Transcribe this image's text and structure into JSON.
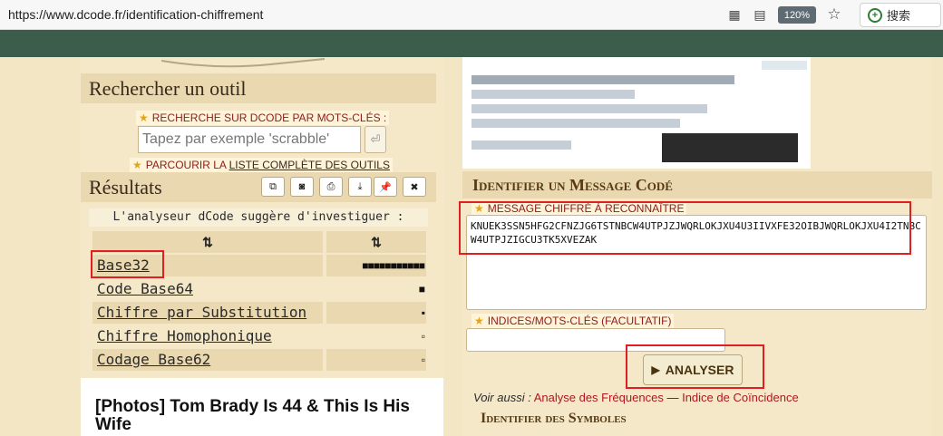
{
  "browser": {
    "url": "https://www.dcode.fr/identification-chiffrement",
    "zoom": "120%",
    "search_label": "搜索"
  },
  "left": {
    "search_title": "Rechercher un outil",
    "keyword_label": "RECHERCHE SUR DCODE PAR MOTS-CLÉS :",
    "search_placeholder": "Tapez par exemple 'scrabble'",
    "browse_prefix": "PARCOURIR LA",
    "browse_link": "LISTE COMPLÈTE DES OUTILS",
    "results_title": "Résultats",
    "analyser_message": "L'analyseur dCode suggère d'investiguer :",
    "sort_icon": "⇅",
    "results": [
      {
        "name": "Base32",
        "score_bar": "■■■■■■■■■■■"
      },
      {
        "name": "Code Base64",
        "score_bar": "■"
      },
      {
        "name": "Chiffre par Substitution",
        "score_bar": "▪"
      },
      {
        "name": "Chiffre Homophonique",
        "score_bar": "▫"
      },
      {
        "name": "Codage Base62",
        "score_bar": "▫"
      }
    ],
    "ad_headline": "[Photos] Tom Brady Is 44 & This Is His Wife"
  },
  "right": {
    "identify_title": "Identifier un Message Codé",
    "cipher_label": "MESSAGE CHIFFRÉ À RECONNAÎTRE",
    "cipher_text": "KNUEK3SSN5HFG2CFNZJG6TSTNBCW4UTPJZJWQRLOKJXU4U3IIVXFE32OIBJWQRLOKJXU4I2TNBCW4UTPJZIGCU3TK5XVEZAK",
    "hints_label": "INDICES/MOTS-CLÉS (FACULTATIF)",
    "analyse_button": "ANALYSER",
    "see_also_prefix": "Voir aussi :",
    "see_also_link1": "Analyse des Fréquences",
    "see_also_sep": "—",
    "see_also_link2": "Indice de Coïncidence",
    "symbols_title": "Identifier des Symboles"
  },
  "colors": {
    "header_green": "#3c5d4b",
    "background": "#f3e6c4",
    "highlight_red": "#e02020",
    "link_red": "#b0171f"
  }
}
